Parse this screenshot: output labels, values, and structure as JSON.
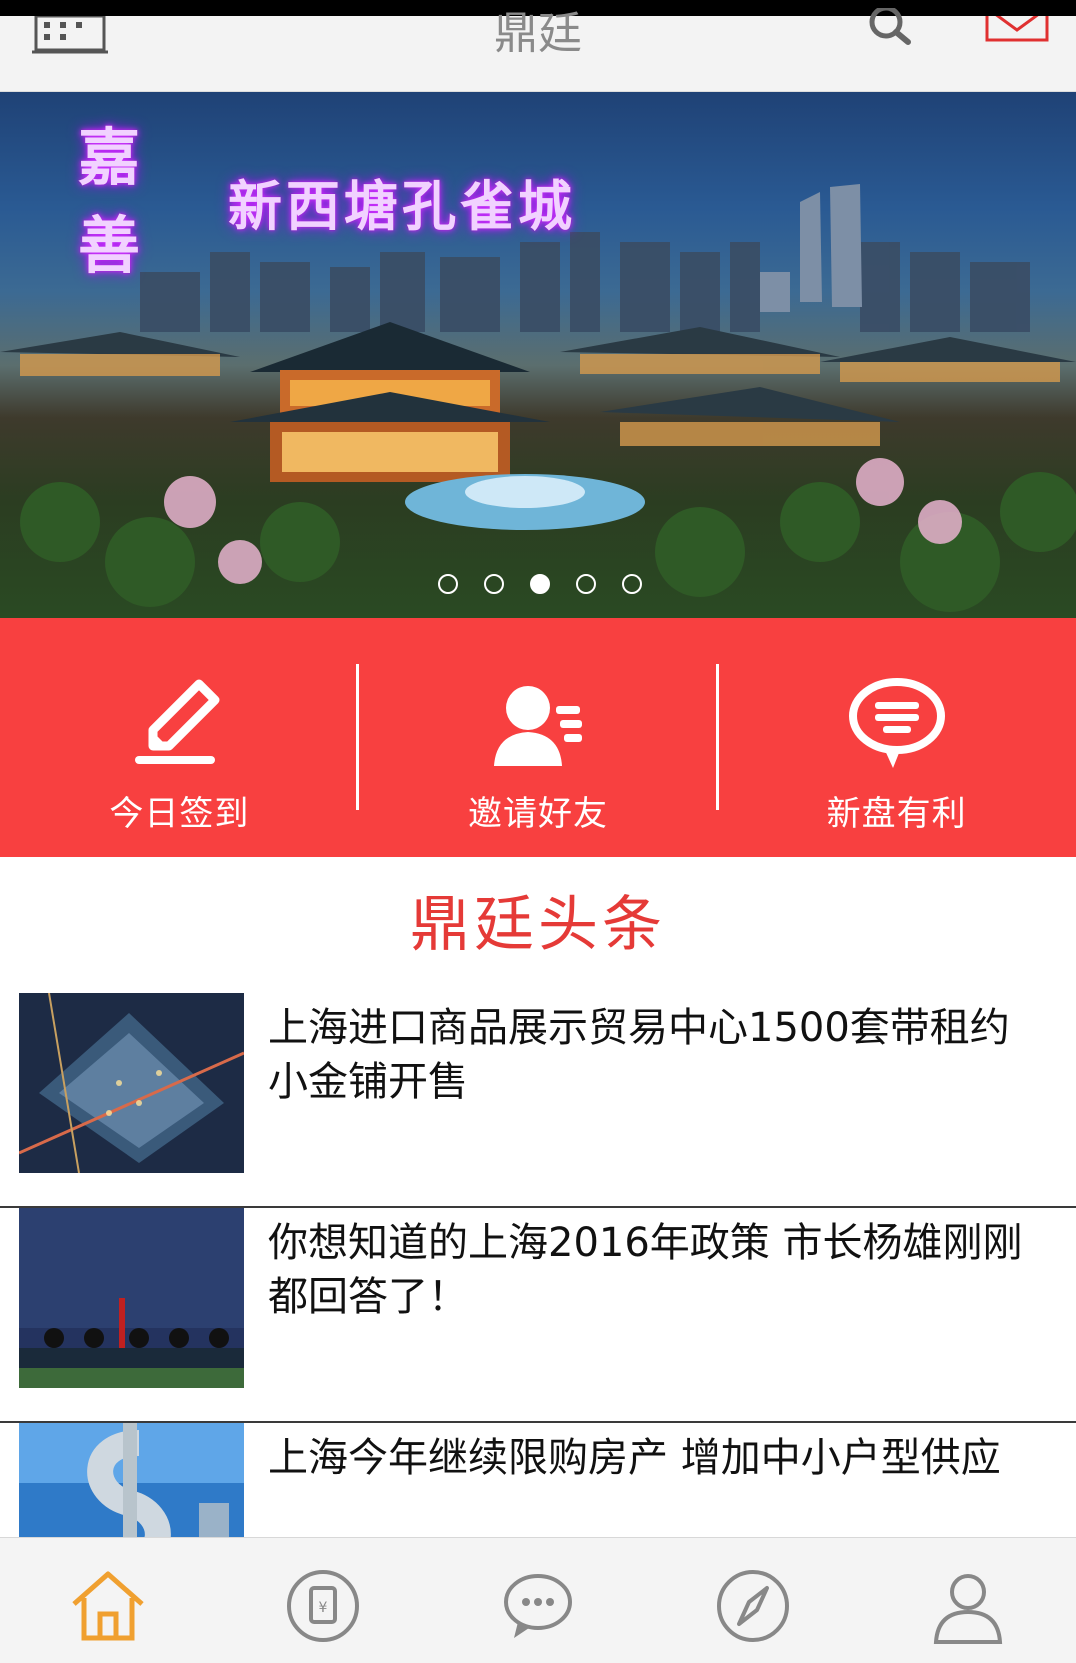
{
  "header": {
    "title": "鼎廷"
  },
  "banner": {
    "brand": "嘉善",
    "title": "新西塘孔雀城",
    "dots": [
      false,
      false,
      true,
      false,
      false
    ]
  },
  "quick_actions": [
    {
      "label": "今日签到",
      "icon": "pencil-icon"
    },
    {
      "label": "邀请好友",
      "icon": "invite-friend-icon"
    },
    {
      "label": "新盘有利",
      "icon": "chat-bubble-icon"
    }
  ],
  "section": {
    "title": "鼎廷头条"
  },
  "news": [
    {
      "title": "上海进口商品展示贸易中心1500套带租约小金铺开售",
      "thumb": "aerial-city-photo"
    },
    {
      "title": "你想知道的上海2016年政策 市长杨雄刚刚都回答了！",
      "thumb": "press-conference-photo"
    },
    {
      "title": "上海今年继续限购房产 增加中小户型供应",
      "thumb": "dollar-sculpture-photo"
    }
  ],
  "bottom_nav": [
    {
      "icon": "home-icon",
      "active": true
    },
    {
      "icon": "wallet-icon",
      "active": false
    },
    {
      "icon": "message-icon",
      "active": false
    },
    {
      "icon": "compass-icon",
      "active": false
    },
    {
      "icon": "user-icon",
      "active": false
    }
  ],
  "colors": {
    "accent": "#f84040",
    "headline": "#e53a37",
    "nav_active": "#f0a030",
    "nav_inactive": "#888888"
  }
}
